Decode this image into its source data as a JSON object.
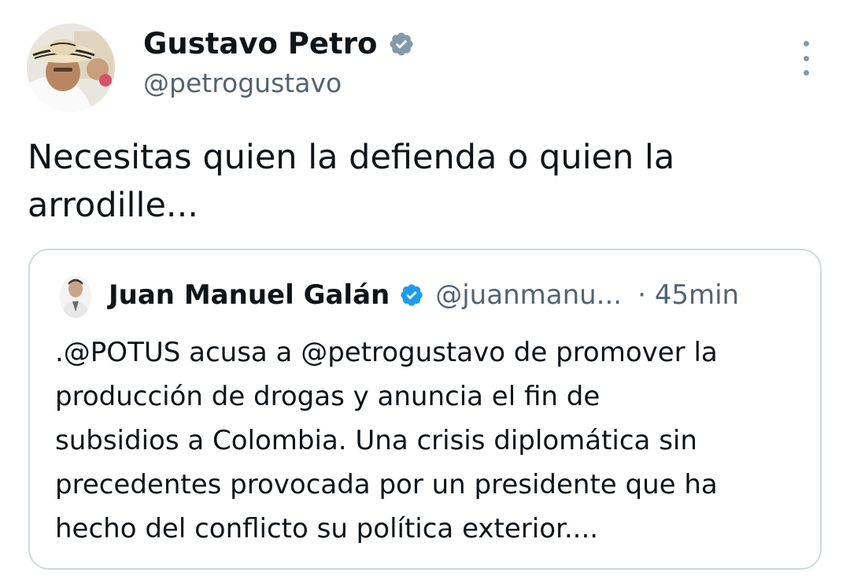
{
  "tweet": {
    "author_name": "Gustavo Petro",
    "author_handle": "@petrogustavo",
    "text_line1": "Necesitas quien la defienda o quien la",
    "text_line2": "arrodille...",
    "more_icon": "more-vertical-icon",
    "verified_icon": "verified-badge-icon"
  },
  "quote": {
    "author_name": "Juan Manuel Galán",
    "author_handle": "@juanmanu...",
    "time": "· 45min",
    "text_lines": [
      ".@POTUS acusa a @petrogustavo de promover la",
      "producción de drogas y anuncia el fin de",
      "subsidios a Colombia. Una crisis diplomática sin",
      "precedentes provocada por un presidente que ha",
      "hecho del conflicto su política exterior...."
    ]
  },
  "colors": {
    "text": "#0f1419",
    "secondary": "#536471",
    "border": "#cfd9de",
    "verified_petro": "#829aab",
    "verified_galan": "#1d9bf0"
  }
}
